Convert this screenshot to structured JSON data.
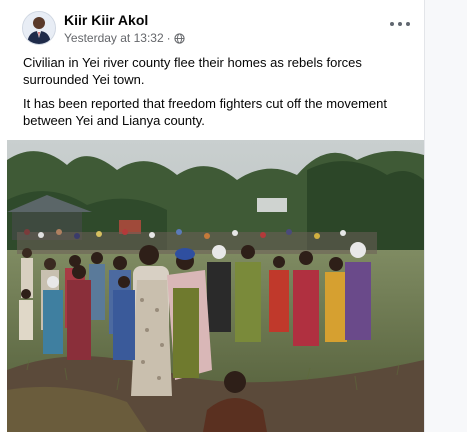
{
  "post": {
    "author": "Kiir Kiir Akol",
    "timestamp": "Yesterday at 13:32",
    "separator": "·",
    "audience_icon": "globe-icon",
    "more_icon": "more-options-icon",
    "paragraphs": [
      "Civilian in Yei river county flee their homes as rebels forces surrounded Yei town.",
      "It has been reported that freedom fighters cut off the movement between Yei and Lianya county."
    ],
    "photo_icon": "crowd-walking-photo"
  },
  "colors": {
    "text_primary": "#050505",
    "text_secondary": "#65676b",
    "card_background": "#ffffff"
  }
}
